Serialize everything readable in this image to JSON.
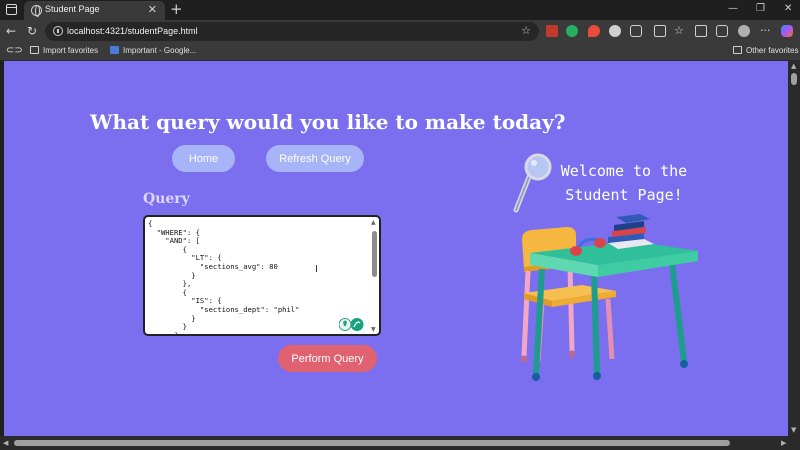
{
  "browser": {
    "tab_title": "Student Page",
    "tab_close": "✕",
    "new_tab": "+",
    "url": "localhost:4321/studentPage.html",
    "bookmarks": [
      {
        "label": "Import favorites"
      },
      {
        "label": "Important - Google..."
      }
    ],
    "other_favorites": "Other favorites",
    "window_controls": [
      "—",
      "❐",
      "✕"
    ],
    "icons": [
      "back-arrow",
      "refresh",
      "info",
      "star",
      "split-screen",
      "favorites",
      "collections",
      "extensions",
      "profile",
      "more",
      "copilot"
    ]
  },
  "page": {
    "title": "What query would you like to make today?",
    "buttons": {
      "home": "Home",
      "refresh": "Refresh Query",
      "perform": "Perform Query"
    },
    "query_label": "Query",
    "query_text": "{\n  \"WHERE\": {\n    \"AND\": [\n        {\n          \"LT\": {\n            \"sections_avg\": 80\n          }\n        },\n        {\n          \"IS\": {\n            \"sections_dept\": \"phil\"\n          }\n        }\n      ]",
    "welcome_line1": "Welcome to the",
    "welcome_line2": "Student Page!",
    "colors": {
      "background": "#7b6ff0",
      "pill_blue": "#a7b4f7",
      "pill_red": "#e06271"
    }
  }
}
